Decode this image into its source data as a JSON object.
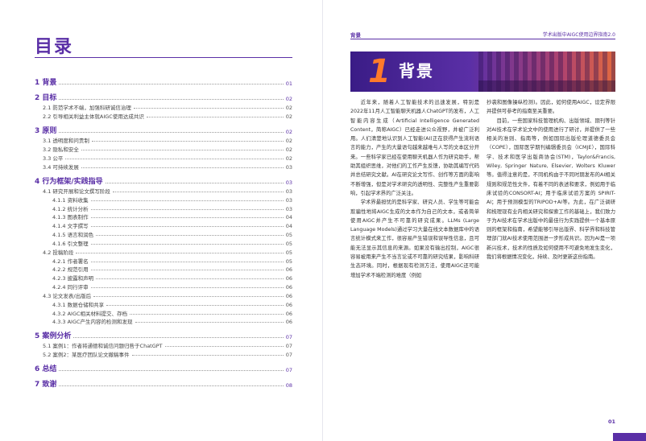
{
  "left_page": {
    "title": "目录",
    "toc": [
      {
        "level": 1,
        "label": "1 背景",
        "page": "01"
      },
      {
        "level": 1,
        "label": "2 目标",
        "page": "02"
      },
      {
        "level": 2,
        "label": "2.1 防范学术不端，加强科研诚信治理",
        "page": "02"
      },
      {
        "level": 2,
        "label": "2.2 引导相关利益主体就AIGC使用达成共识",
        "page": "02"
      },
      {
        "level": 1,
        "label": "3 原则",
        "page": "02"
      },
      {
        "level": 2,
        "label": "3.1 透明度和问责制",
        "page": "02"
      },
      {
        "level": 2,
        "label": "3.2 隐私和安全",
        "page": "02"
      },
      {
        "level": 2,
        "label": "3.3 公平",
        "page": "02"
      },
      {
        "level": 2,
        "label": "3.4 可持续发展",
        "page": "03"
      },
      {
        "level": 1,
        "label": "4 行为框架/实践指导",
        "page": "03"
      },
      {
        "level": 2,
        "label": "4.1 研究开展和论文撰写阶段",
        "page": "03"
      },
      {
        "level": 3,
        "label": "4.1.1 资料收集",
        "page": "03"
      },
      {
        "level": 3,
        "label": "4.1.2 统计分析",
        "page": "03"
      },
      {
        "level": 3,
        "label": "4.1.3 图表制作",
        "page": "04"
      },
      {
        "level": 3,
        "label": "4.1.4 文字撰写",
        "page": "04"
      },
      {
        "level": 3,
        "label": "4.1.5 语言和润色",
        "page": "05"
      },
      {
        "level": 3,
        "label": "4.1.6 引文整理",
        "page": "05"
      },
      {
        "level": 2,
        "label": "4.2 投稿阶段",
        "page": "05"
      },
      {
        "level": 3,
        "label": "4.2.1 作者署名",
        "page": "05"
      },
      {
        "level": 3,
        "label": "4.2.2 规范引用",
        "page": "06"
      },
      {
        "level": 3,
        "label": "4.2.3 披露和声明",
        "page": "06"
      },
      {
        "level": 3,
        "label": "4.2.4 同行评审",
        "page": "06"
      },
      {
        "level": 2,
        "label": "4.3 论文发表/出版后",
        "page": "06"
      },
      {
        "level": 3,
        "label": "4.3.1 数据仓储和共享",
        "page": "06"
      },
      {
        "level": 3,
        "label": "4.3.2 AIGC相关材料提交、存档",
        "page": "06"
      },
      {
        "level": 3,
        "label": "4.3.3 AIGC产生内容的检测和发现",
        "page": "06"
      },
      {
        "level": 1,
        "label": "5 案例分析",
        "page": "07"
      },
      {
        "level": 2,
        "label": "5.1 案例1：作者将通德和诚信问题归咎于ChatGPT",
        "page": "07"
      },
      {
        "level": 2,
        "label": "5.2 案例2：某医疗团队论文撤稿事件",
        "page": "07"
      },
      {
        "level": 1,
        "label": "6 总结",
        "page": "07"
      },
      {
        "level": 1,
        "label": "7 致谢",
        "page": "08"
      }
    ]
  },
  "right_page": {
    "header_left": "背景",
    "header_right": "学术出版中AIGC使用边界指南2.0",
    "section_number": "1",
    "section_title": "背景",
    "col1": [
      "近年来，随着人工智能技术的迅速发展，特别是2022年11月人工智能聊天机器人ChatGPT的发布，人工智能内容生成（Artificial Intelligence Generated Content，简称AIGC）已经走进公众视野，并被广泛利用。人们清楚地认识到人工智能(AI)正在获得产生流利语言的能力，产生的大量语句越来越难与人写的文本区分开来。一些科学家已经在使用聊天机器人作为研究助手，帮助其组织思维，对他们的工作产生反馈，协助其编写代码并总结研究文献。AI在研究论文写作、创作等方面的影响不断增强，但是对学术研究的透明性、完整性产生重要影响，引起学术界的广泛关注。",
      "学术界最担忧的是科学家、研究人员、学生等可能会欺骗性地将AIGC生成的文本作为自己的文本，或者简单使用AIGC并产生不可靠的研究成果。LLMs (Large Language Models)通过学习大量在线文本数据库中的语言统计模式来工作，很容易产生错误和误导性信息，且可能无法显示其信息的来源。如果没有输出控制，AIGC很容易被用来产生不当言论或不可靠的研究结果，影响科研生态环境。同时，根据现有检测方法，使用AIGC还可能增加学术不端检测的难度（例如"
    ],
    "col2": [
      "抄袭和图像操纵检测)。因此，如何使用AIGC，设定界限并提供可参考的指南至关重要。",
      "目前，一些国家科技管理机构、出版领域、期刊等针对AI技术在学术论文中的使用进行了研讨，并提供了一些相关的准则、指南等，例如国际出版伦理道德委员会（COPE），国际医学期刊编辑委员会（ICMJE），国际科学、技术和医学出版商协会(STM)，Taylor&Francis, Wiley, Springer Nature, Elsevier, Wolters Kluwer等。值得注意的是，不同机构由于不同时期发布的AI相关规则和规范性文件，有着不同的表述和要求，例如用于临床试验的CONSORT-AI；用于临床试验方案的 SPIRIT-AI；用于预测模型的TRIPOD+AI等。为此，在广泛调研和梳理现有业内相关研究和探索工作的基础上，我们致力于为AI技术在学术出版中的最佳行为实践提供一个基本原则的框架和指南，希望能够引导出版界、科学界和科技管理部门就AI技术使用范围进一步形成共识。因为AI是一项新兴技术，技术的性质及如何使用不可避免地发生变化，我们将根据情况变化，持续、及时更新这份指南。"
    ],
    "page_number": "01"
  }
}
